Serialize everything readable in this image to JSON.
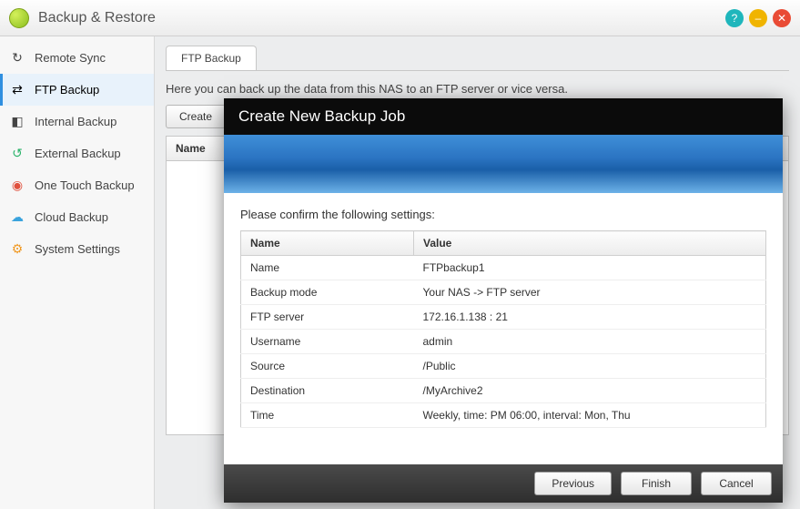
{
  "titlebar": {
    "title": "Backup & Restore"
  },
  "sidebar": {
    "items": [
      {
        "label": "Remote Sync",
        "icon": "↻",
        "color": "#3aa3dd"
      },
      {
        "label": "FTP Backup",
        "icon": "⇄",
        "color": "#555"
      },
      {
        "label": "Internal Backup",
        "icon": "◧",
        "color": "#666"
      },
      {
        "label": "External Backup",
        "icon": "↺",
        "color": "#2bb36a"
      },
      {
        "label": "One Touch Backup",
        "icon": "◉",
        "color": "#e0503d"
      },
      {
        "label": "Cloud Backup",
        "icon": "☁",
        "color": "#3aa3dd"
      },
      {
        "label": "System Settings",
        "icon": "⚙",
        "color": "#f09923"
      }
    ],
    "active_index": 1
  },
  "main": {
    "tab": "FTP Backup",
    "description": "Here you can back up the data from this NAS to an FTP server or vice versa.",
    "buttons": {
      "create": "Create"
    },
    "grid_header": "Name"
  },
  "dialog": {
    "title": "Create New Backup Job",
    "prompt": "Please confirm the following settings:",
    "headers": {
      "name": "Name",
      "value": "Value"
    },
    "rows": [
      {
        "k": "Name",
        "v": "FTPbackup1"
      },
      {
        "k": "Backup mode",
        "v": "Your NAS -> FTP server"
      },
      {
        "k": "FTP server",
        "v": "172.16.1.138 : 21"
      },
      {
        "k": "Username",
        "v": "admin"
      },
      {
        "k": "Source",
        "v": "/Public"
      },
      {
        "k": "Destination",
        "v": "/MyArchive2"
      },
      {
        "k": "Time",
        "v": "Weekly, time: PM 06:00, interval: Mon, Thu"
      }
    ],
    "buttons": {
      "previous": "Previous",
      "finish": "Finish",
      "cancel": "Cancel"
    }
  }
}
